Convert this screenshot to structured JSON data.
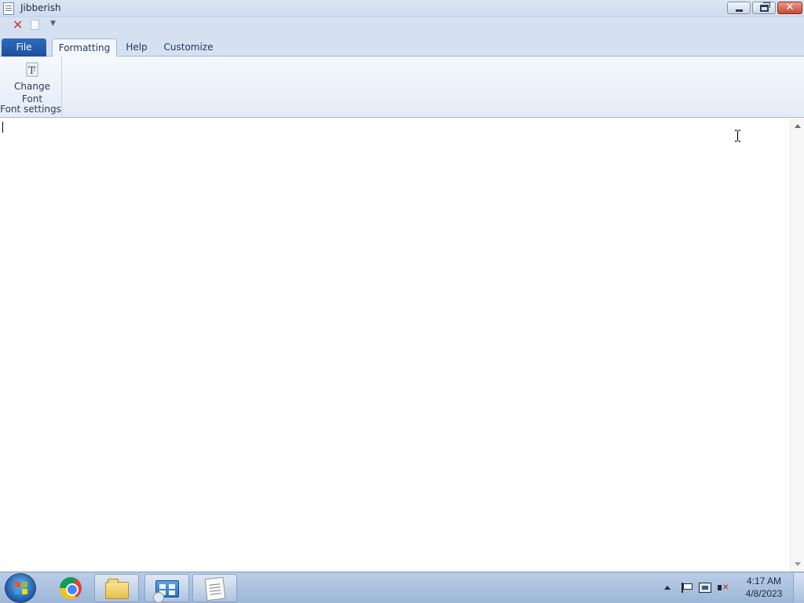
{
  "window": {
    "title": "Jibberish",
    "minimize_label": "",
    "restore_label": "",
    "close_glyph": "✕"
  },
  "quick_access": {
    "undo_icon": "red-x-icon",
    "new_icon": "document-icon",
    "customize_icon": "dropdown-arrow-icon"
  },
  "ribbon": {
    "tabs": [
      {
        "label": "File"
      },
      {
        "label": "Formatting"
      },
      {
        "label": "Help"
      },
      {
        "label": "Customize"
      }
    ],
    "active_tab": "Formatting",
    "groups": [
      {
        "label": "Font settings",
        "buttons": [
          {
            "label_line1": "Change",
            "label_line2": "Font",
            "icon": "change-font-icon"
          }
        ]
      }
    ]
  },
  "editor": {
    "content": ""
  },
  "taskbar": {
    "items": [
      {
        "name": "start-button",
        "icon": "windows-orb-icon"
      },
      {
        "name": "chrome",
        "icon": "chrome-icon"
      },
      {
        "name": "file-explorer",
        "icon": "folder-icon"
      },
      {
        "name": "control-panel",
        "icon": "control-panel-icon"
      },
      {
        "name": "jibberish",
        "icon": "notepad-icon"
      }
    ],
    "clock": {
      "time": "4:17 AM",
      "date": "4/8/2023"
    }
  },
  "colors": {
    "file_tab": "#2459a8",
    "titlebar": "#d6e2f2",
    "close_button": "#c84a33"
  }
}
